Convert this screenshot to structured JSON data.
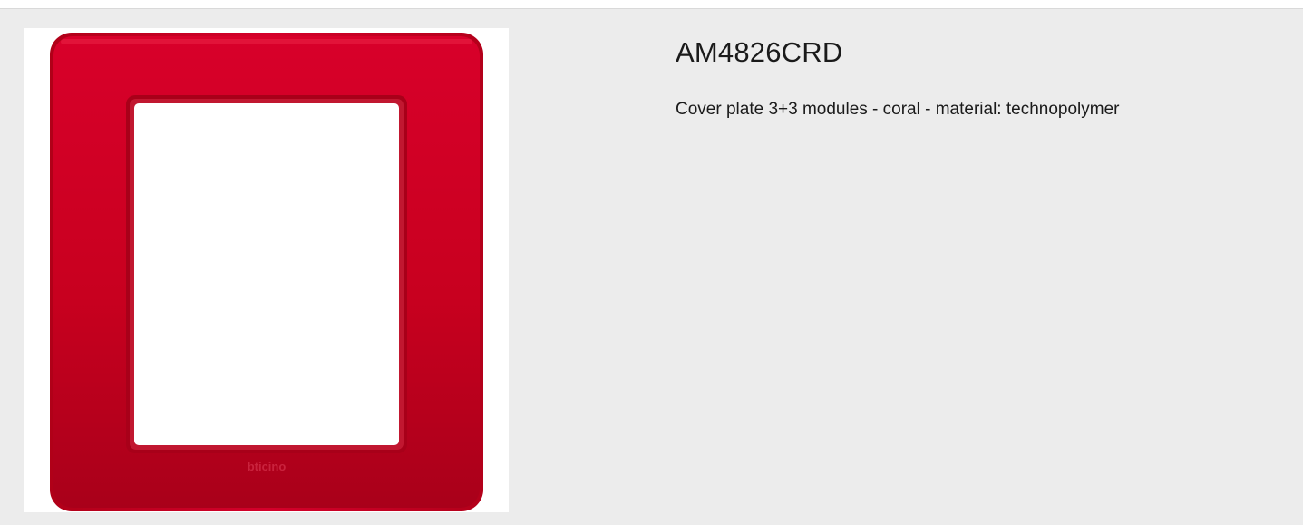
{
  "product": {
    "code": "AM4826CRD",
    "description": "Cover plate 3+3 modules - coral - material: technopolymer",
    "brand_mark": "bticino",
    "image_alt": "AM4826CRD cover plate",
    "plate_color": "#c8001e",
    "background_color": "#ececec"
  }
}
